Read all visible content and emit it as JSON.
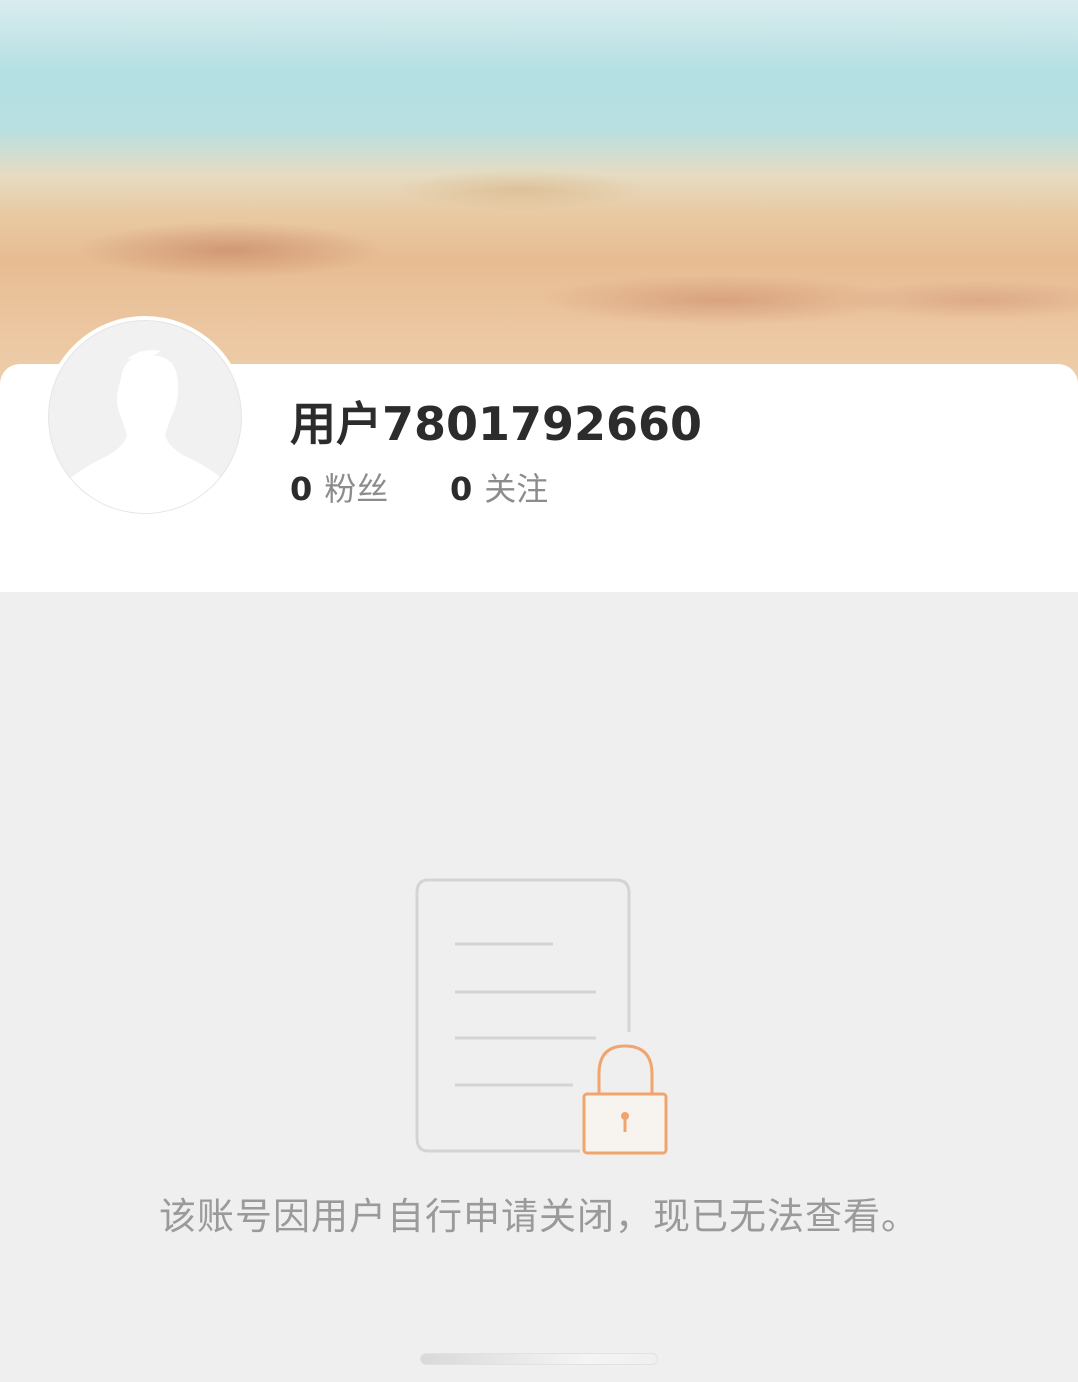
{
  "profile": {
    "username": "用户7801792660",
    "fans_count": "0",
    "fans_label": "粉丝",
    "following_count": "0",
    "following_label": "关注",
    "avatar_icon": "default-avatar-icon"
  },
  "cover": {
    "image": "beach-sand-cover-image"
  },
  "notice": {
    "icon": "locked-document-icon",
    "message": "该账号因用户自行申请关闭，现已无法查看。"
  },
  "colors": {
    "accent": "#f0a56e",
    "text_primary": "#2c2c2c",
    "text_secondary": "#8c8c8c",
    "message_text": "#9a9a9a",
    "page_background": "#efefef"
  }
}
